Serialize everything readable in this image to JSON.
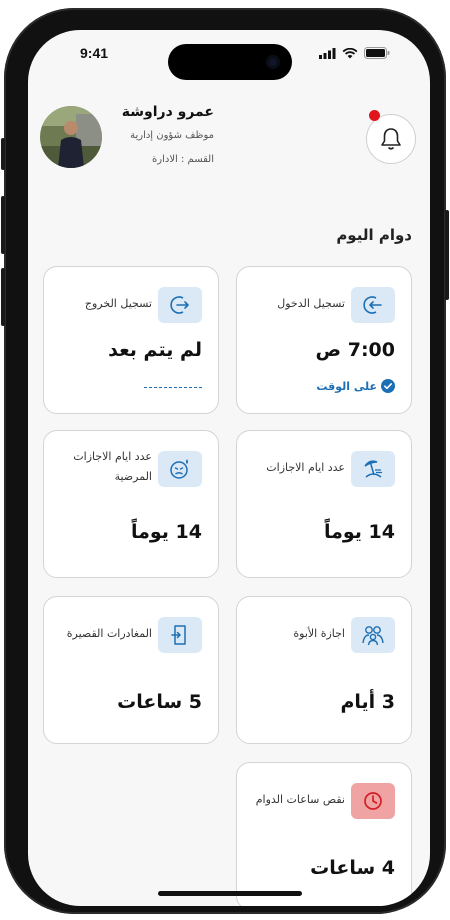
{
  "status_bar": {
    "time": "9:41"
  },
  "header": {
    "name": "عمرو دراوشة",
    "role": "موظف شؤون إدارية",
    "department": "القسم : الادارة"
  },
  "section_title": "دوام اليوم",
  "cards": {
    "check_in": {
      "label": "تسجيل الدخول",
      "value": "7:00 ص",
      "status": "على الوقت"
    },
    "check_out": {
      "label": "تسجيل الخروج",
      "value": "لم يتم بعد"
    },
    "leave_days": {
      "label": "عدد ايام الاجازات",
      "value": "14 يوماً"
    },
    "sick_leave_days": {
      "label": "عدد ايام الاجازات المرضية",
      "value": "14 يوماً"
    },
    "paternity_leave": {
      "label": "اجازة الأبوة",
      "value": "3 أيام"
    },
    "short_leaves": {
      "label": "المغادرات القصيرة",
      "value": "5 ساعات"
    },
    "hours_shortage": {
      "label": "نقص ساعات الدوام",
      "value": "4 ساعات"
    }
  },
  "colors": {
    "accent": "#1c6fb4",
    "icon_bg": "#dbe9f6",
    "alert": "#e0141a",
    "alert_bg": "#f0a3a3"
  },
  "icons": [
    "bell-icon",
    "login-icon",
    "logout-icon",
    "beach-icon",
    "sick-face-icon",
    "family-icon",
    "exit-door-icon",
    "clock-icon",
    "check-circle-icon"
  ]
}
